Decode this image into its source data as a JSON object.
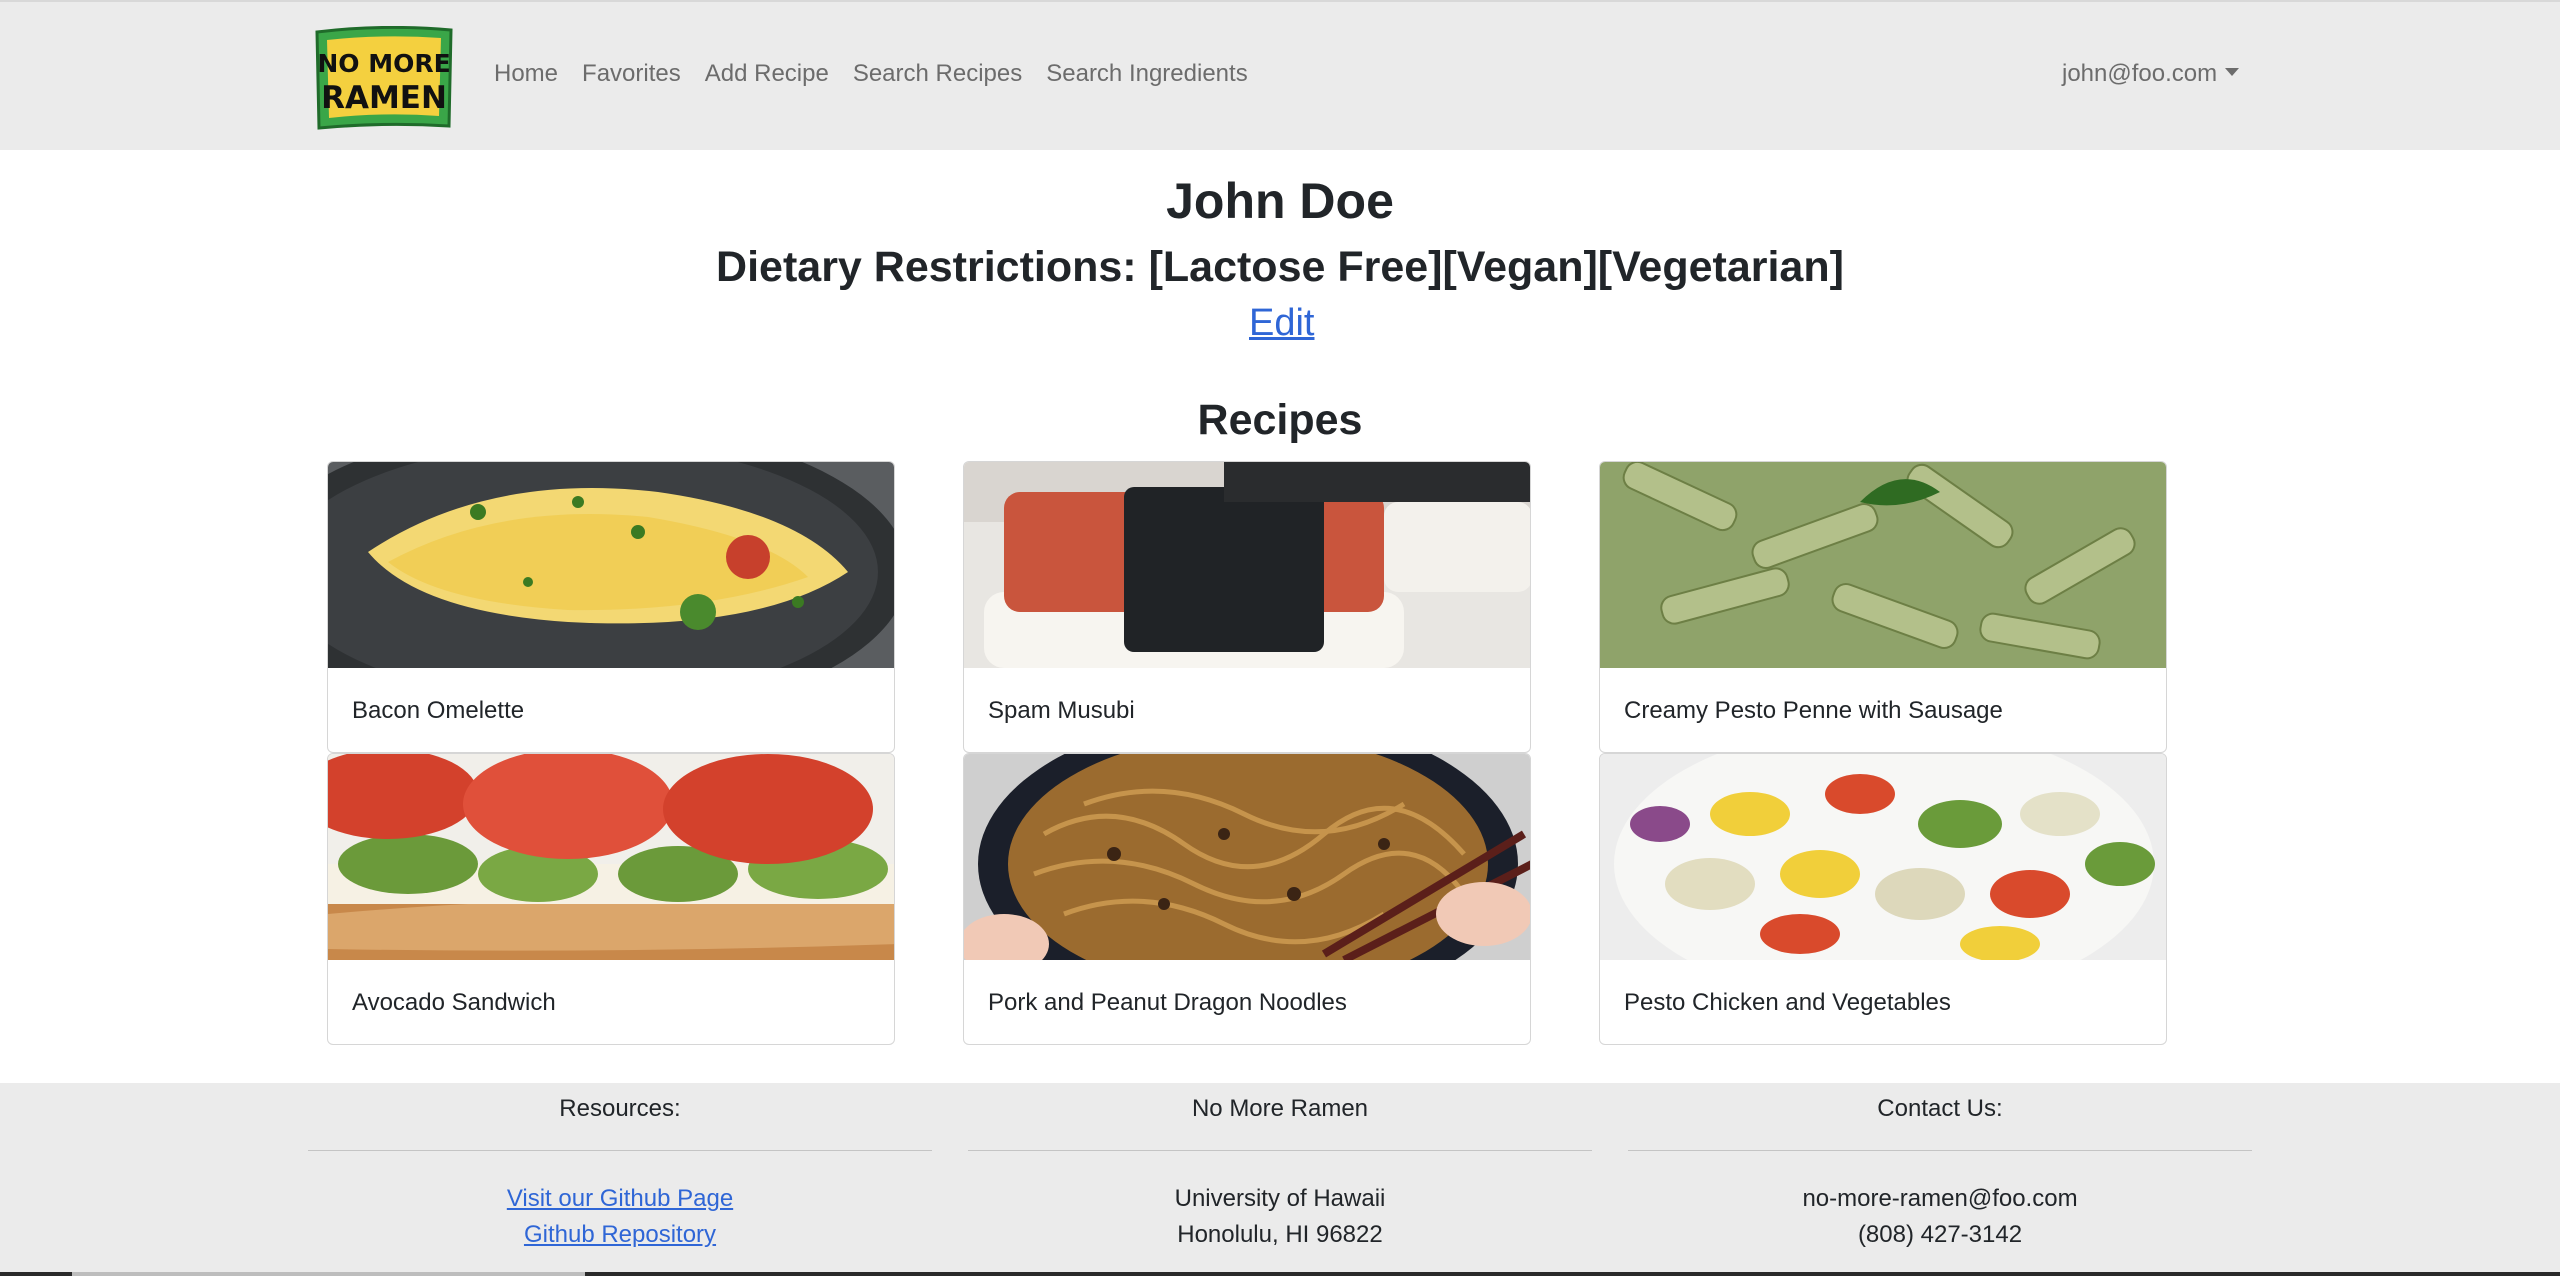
{
  "navbar": {
    "logo_text_top": "NO MORE",
    "logo_text_bottom": "RAMEN",
    "links": [
      "Home",
      "Favorites",
      "Add Recipe",
      "Search Recipes",
      "Search Ingredients"
    ],
    "user_email": "john@foo.com"
  },
  "profile": {
    "name": "John Doe",
    "dietary_restrictions": "Dietary Restrictions: [Lactose Free][Vegan][Vegetarian]",
    "edit_label": "Edit"
  },
  "recipes": {
    "heading": "Recipes",
    "items": [
      {
        "title": "Bacon Omelette"
      },
      {
        "title": "Spam Musubi"
      },
      {
        "title": "Creamy Pesto Penne with Sausage"
      },
      {
        "title": "Avocado Sandwich"
      },
      {
        "title": "Pork and Peanut Dragon Noodles"
      },
      {
        "title": "Pesto Chicken and Vegetables"
      }
    ]
  },
  "footer": {
    "resources": {
      "heading": "Resources:",
      "links": [
        "Visit our Github Page",
        "Github Repository"
      ]
    },
    "center": {
      "heading": "No More Ramen",
      "lines": [
        "University of Hawaii",
        "Honolulu, HI 96822"
      ]
    },
    "contact": {
      "heading": "Contact Us:",
      "lines": [
        "no-more-ramen@foo.com",
        "(808) 427-3142"
      ]
    }
  },
  "colors": {
    "navbar_bg": "#ebebeb",
    "link_blue": "#2f66d6",
    "logo_green": "#3aa648",
    "logo_yellow": "#f4d03f"
  }
}
